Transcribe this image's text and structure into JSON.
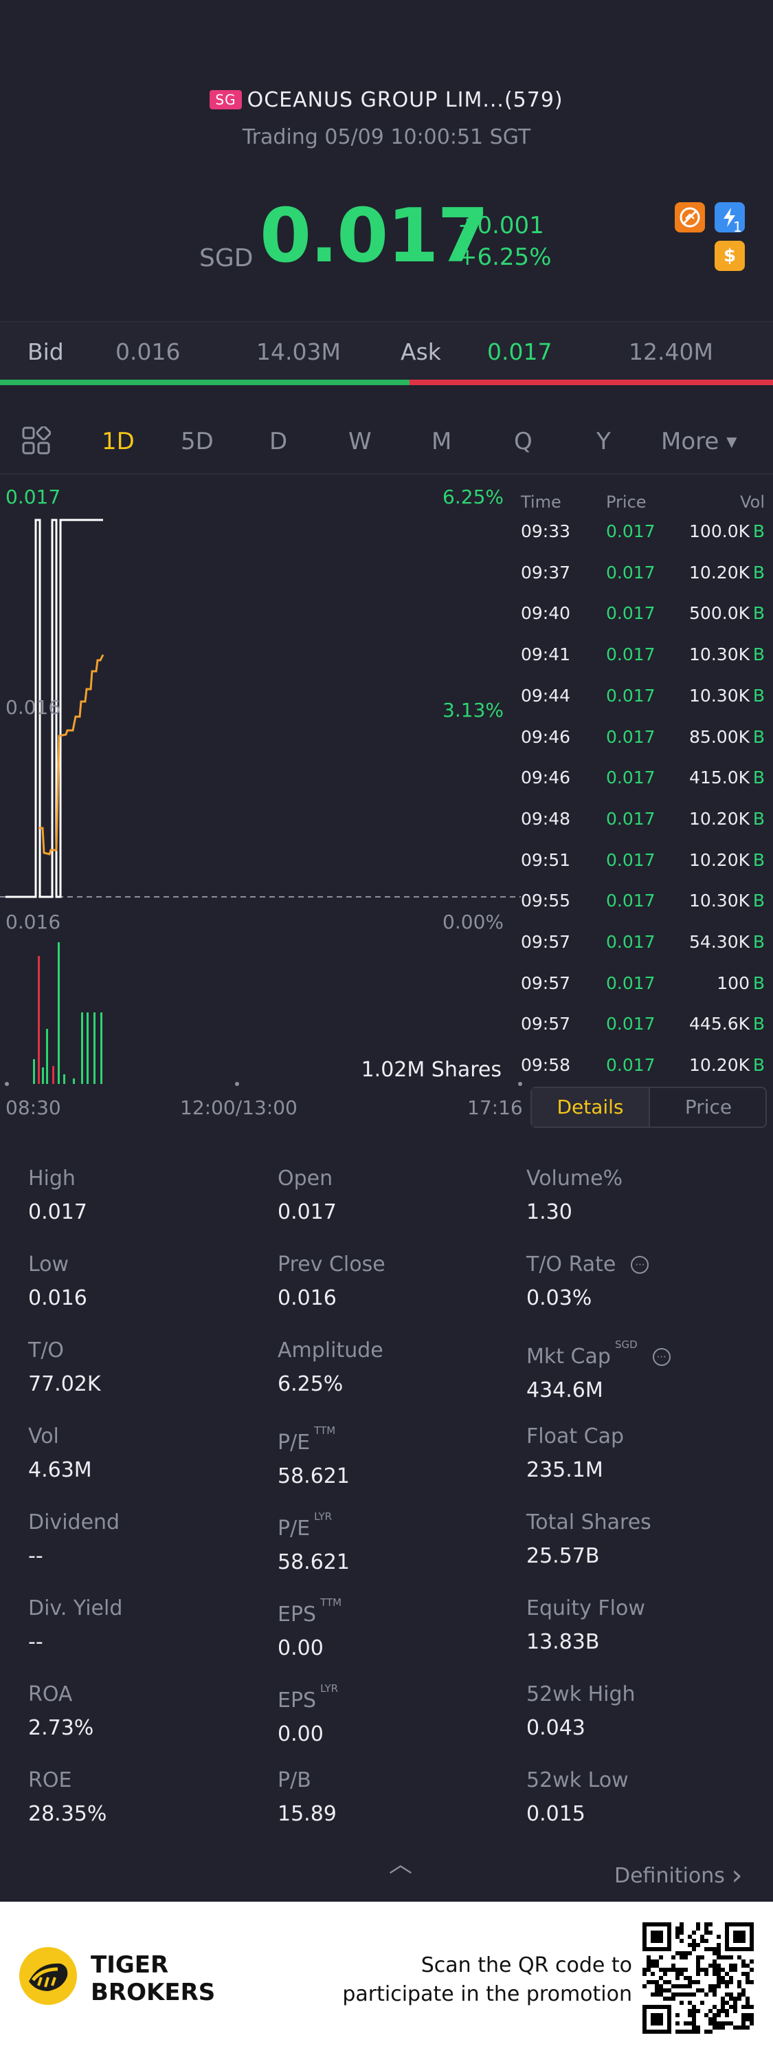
{
  "header": {
    "market_badge": "SG",
    "title": "OCEANUS GROUP LIM...(579)",
    "subtitle": "Trading 05/09 10:00:51 SGT"
  },
  "quote": {
    "currency": "SGD",
    "price": "0.017",
    "change": "+0.001",
    "change_pct": "+6.25%",
    "icons": [
      "no-short-icon",
      "lightning-icon",
      "dollar-icon"
    ],
    "lightning_badge": "1",
    "dollar_symbol": "$"
  },
  "bidask": {
    "bid_label": "Bid",
    "bid_price": "0.016",
    "bid_size": "14.03M",
    "ask_label": "Ask",
    "ask_price": "0.017",
    "ask_size": "12.40M",
    "bid_share": 0.53
  },
  "tabs": {
    "items": [
      "1D",
      "5D",
      "D",
      "W",
      "M",
      "Q",
      "Y",
      "More"
    ],
    "active": "1D",
    "more_caret": "▼"
  },
  "chart": {
    "price_top": "0.017",
    "price_mid": "0.016",
    "price_bottom": "0.016",
    "pct_top": "6.25%",
    "pct_mid": "3.13%",
    "pct_bottom": "0.00%",
    "volume_label": "1.02M Shares",
    "time_start": "08:30",
    "time_mid": "12:00/13:00",
    "time_end": "17:16"
  },
  "ticks": {
    "headers": {
      "time": "Time",
      "price": "Price",
      "vol": "Vol"
    },
    "rows": [
      {
        "time": "09:33",
        "price": "0.017",
        "vol": "100.0K",
        "side": "B"
      },
      {
        "time": "09:37",
        "price": "0.017",
        "vol": "10.20K",
        "side": "B"
      },
      {
        "time": "09:40",
        "price": "0.017",
        "vol": "500.0K",
        "side": "B"
      },
      {
        "time": "09:41",
        "price": "0.017",
        "vol": "10.30K",
        "side": "B"
      },
      {
        "time": "09:44",
        "price": "0.017",
        "vol": "10.30K",
        "side": "B"
      },
      {
        "time": "09:46",
        "price": "0.017",
        "vol": "85.00K",
        "side": "B"
      },
      {
        "time": "09:46",
        "price": "0.017",
        "vol": "415.0K",
        "side": "B"
      },
      {
        "time": "09:48",
        "price": "0.017",
        "vol": "10.20K",
        "side": "B"
      },
      {
        "time": "09:51",
        "price": "0.017",
        "vol": "10.20K",
        "side": "B"
      },
      {
        "time": "09:55",
        "price": "0.017",
        "vol": "10.30K",
        "side": "B"
      },
      {
        "time": "09:57",
        "price": "0.017",
        "vol": "54.30K",
        "side": "B"
      },
      {
        "time": "09:57",
        "price": "0.017",
        "vol": "100",
        "side": "B"
      },
      {
        "time": "09:57",
        "price": "0.017",
        "vol": "445.6K",
        "side": "B"
      },
      {
        "time": "09:58",
        "price": "0.017",
        "vol": "10.20K",
        "side": "B"
      }
    ],
    "toggle_details": "Details",
    "toggle_price": "Price"
  },
  "stats": [
    {
      "label": "High",
      "value": "0.017"
    },
    {
      "label": "Open",
      "value": "0.017"
    },
    {
      "label": "Volume%",
      "value": "1.30"
    },
    {
      "label": "Low",
      "value": "0.016"
    },
    {
      "label": "Prev Close",
      "value": "0.016"
    },
    {
      "label": "T/O Rate",
      "value": "0.03%",
      "info": true
    },
    {
      "label": "T/O",
      "value": "77.02K"
    },
    {
      "label": "Amplitude",
      "value": "6.25%"
    },
    {
      "label": "Mkt Cap",
      "sup": "SGD",
      "value": "434.6M",
      "info": true
    },
    {
      "label": "Vol",
      "value": "4.63M"
    },
    {
      "label": "P/E",
      "sup": "TTM",
      "value": "58.621"
    },
    {
      "label": "Float Cap",
      "value": "235.1M"
    },
    {
      "label": "Dividend",
      "value": "--"
    },
    {
      "label": "P/E",
      "sup": "LYR",
      "value": "58.621"
    },
    {
      "label": "Total Shares",
      "value": "25.57B"
    },
    {
      "label": "Div. Yield",
      "value": "--"
    },
    {
      "label": "EPS",
      "sup": "TTM",
      "value": "0.00"
    },
    {
      "label": "Equity Flow",
      "value": "13.83B"
    },
    {
      "label": "ROA",
      "value": "2.73%"
    },
    {
      "label": "EPS",
      "sup": "LYR",
      "value": "0.00"
    },
    {
      "label": "52wk High",
      "value": "0.043"
    },
    {
      "label": "ROE",
      "value": "28.35%"
    },
    {
      "label": "P/B",
      "value": "15.89"
    },
    {
      "label": "52wk Low",
      "value": "0.015"
    }
  ],
  "footer_links": {
    "info_symbol": "···",
    "collapse": "︿",
    "definitions": "Definitions",
    "definitions_arrow": "›"
  },
  "promo": {
    "brand_line1": "TIGER",
    "brand_line2": "BROKERS",
    "text_line1": "Scan the QR code to",
    "text_line2": "participate in the promotion"
  },
  "colors": {
    "background": "#21222d",
    "up_green": "#2ed573",
    "down_red": "#e03245",
    "active_tab": "#f5c518",
    "price_line": "#ffffff",
    "avg_line": "#f0a030"
  }
}
